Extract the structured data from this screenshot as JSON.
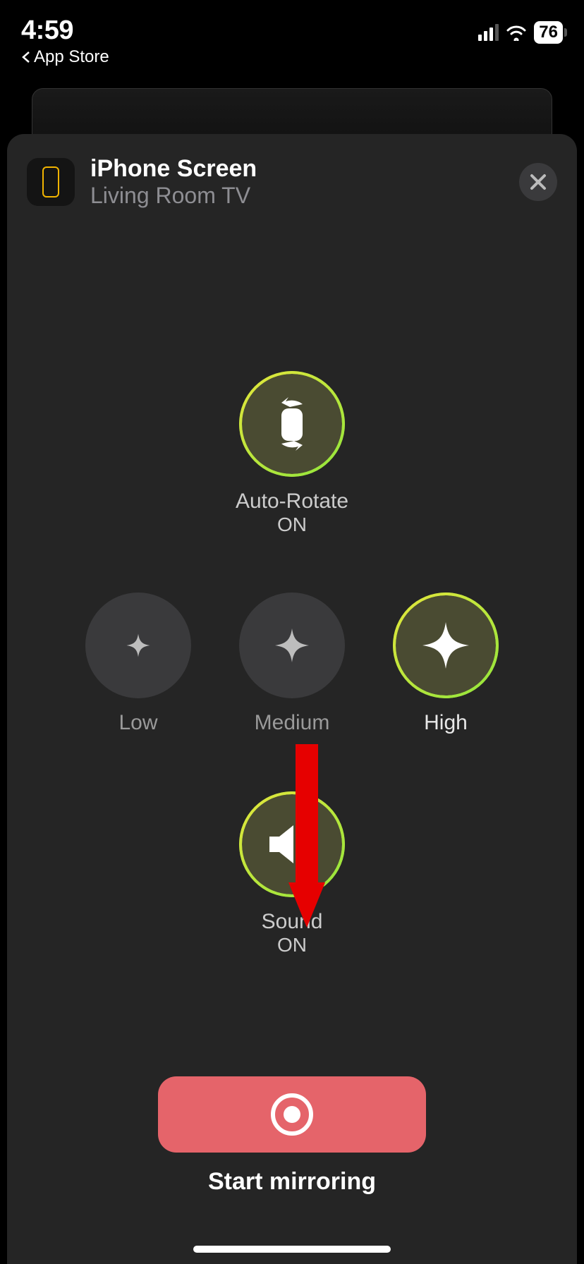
{
  "status": {
    "time": "4:59",
    "back_app": "App Store",
    "battery": "76"
  },
  "sheet": {
    "title": "iPhone Screen",
    "subtitle": "Living Room TV"
  },
  "controls": {
    "autorotate": {
      "label": "Auto-Rotate",
      "state": "ON"
    },
    "quality": {
      "low": "Low",
      "medium": "Medium",
      "high": "High"
    },
    "sound": {
      "label": "Sound",
      "state": "ON"
    },
    "start": {
      "label": "Start mirroring"
    }
  }
}
